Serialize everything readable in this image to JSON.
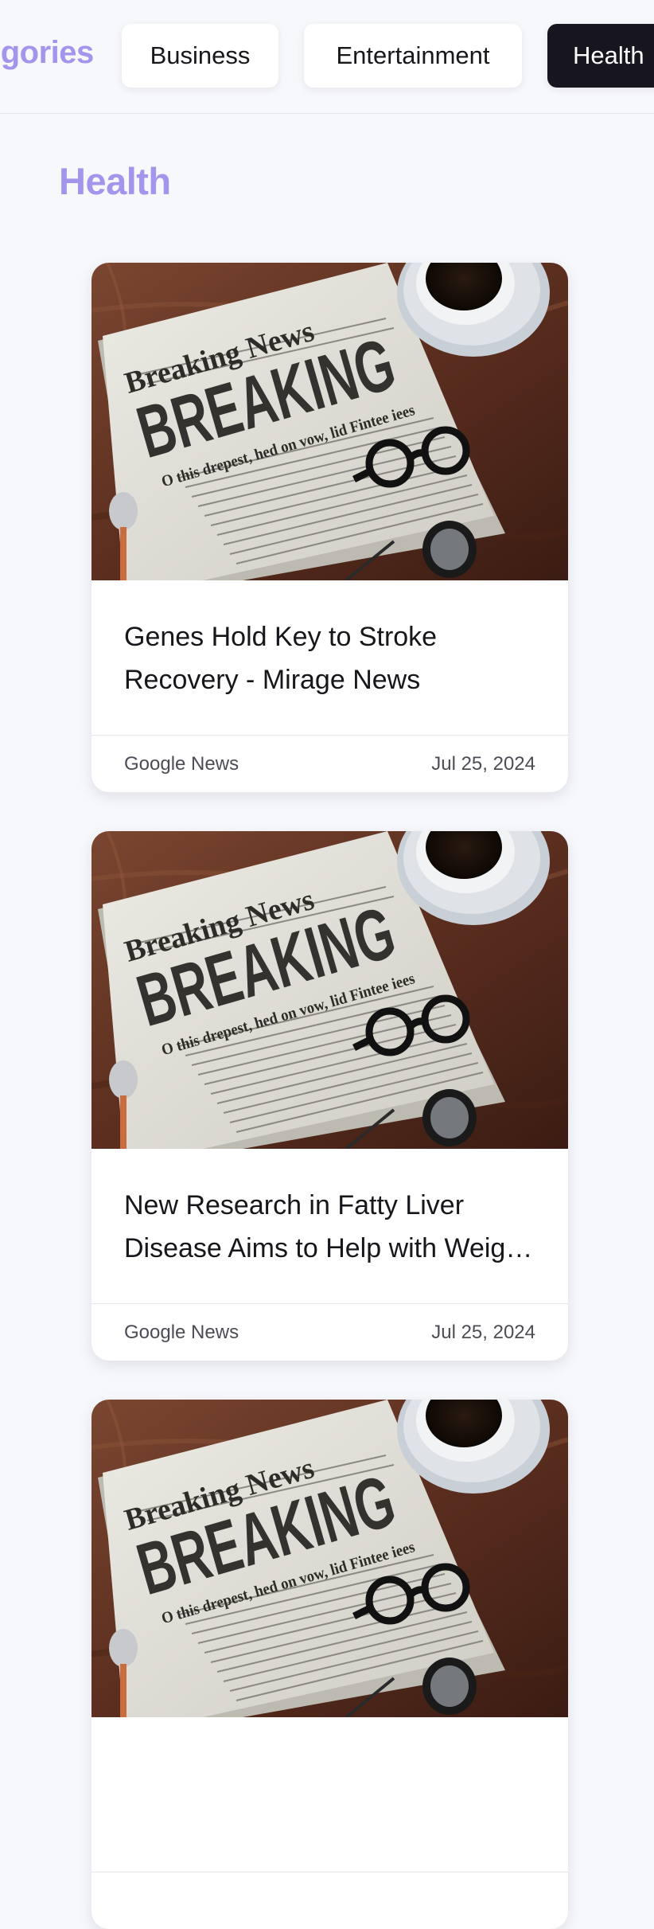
{
  "categories_heading": "Categories",
  "categories": [
    {
      "label": "Business",
      "active": false
    },
    {
      "label": "Entertainment",
      "active": false
    },
    {
      "label": "Health",
      "active": true
    }
  ],
  "section_title": "Health",
  "image": {
    "masthead": "Breaking News",
    "headline": "BREAKING",
    "subhead": "O this drepest, hed on vow, lid Fintee iees"
  },
  "articles": [
    {
      "title": "Genes Hold Key to Stroke Recovery - Mirage News",
      "source": "Google News",
      "date": "Jul 25, 2024"
    },
    {
      "title": "New Research in Fatty Liver Disease Aims to Help with Weight Loss",
      "source": "Google News",
      "date": "Jul 25, 2024"
    },
    {
      "title": "",
      "source": "",
      "date": ""
    }
  ],
  "colors": {
    "accent": "#a394ec",
    "active_pill": "#17161e",
    "background": "#f7f8fc"
  }
}
